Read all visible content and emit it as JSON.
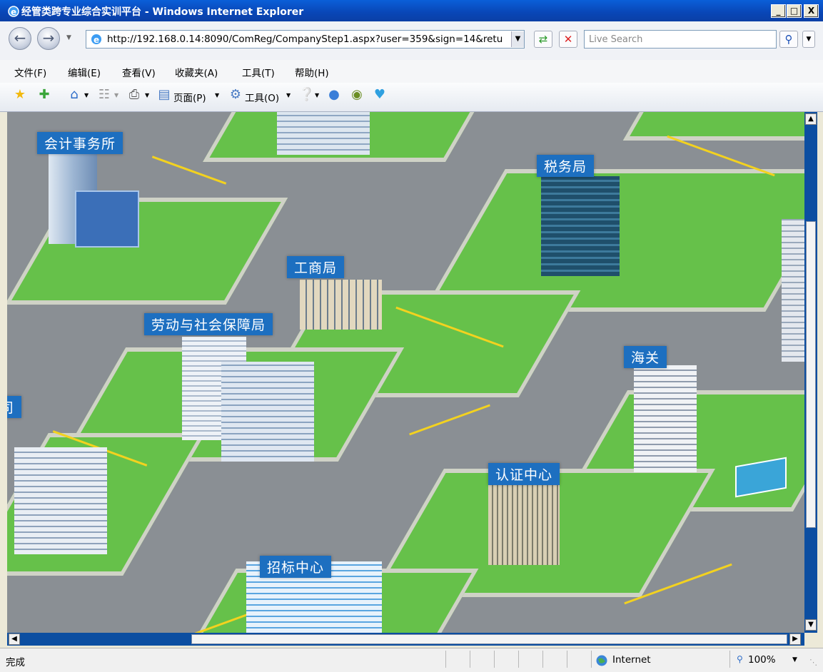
{
  "window": {
    "title": "经管类跨专业综合实训平台 - Windows Internet Explorer",
    "min_label": "_",
    "max_label": "□",
    "close_label": "X"
  },
  "address": {
    "url": "http://192.168.0.14:8090/ComReg/CompanyStep1.aspx?user=359&sign=14&retur",
    "search_placeholder": "Live Search"
  },
  "menu": [
    "文件(F)",
    "编辑(E)",
    "查看(V)",
    "收藏夹(A)",
    "工具(T)",
    "帮助(H)"
  ],
  "commands": {
    "page_label": "页面(P)",
    "tools_label": "工具(O)"
  },
  "map": {
    "labels": {
      "accounting": "会计事务所",
      "tax": "税务局",
      "commerce": "工商局",
      "labor": "劳动与社会保障局",
      "customs": "海关",
      "certification": "认证中心",
      "bidding": "招标中心",
      "company": "司"
    }
  },
  "status": {
    "text": "完成",
    "zone": "Internet",
    "zoom": "100%"
  },
  "colors": {
    "titlebar": "#0a5fd8",
    "label_bg": "#1d6fc0",
    "grass": "#66c14a",
    "road": "#8a8f94",
    "scrollbar": "#0c4ea1"
  }
}
